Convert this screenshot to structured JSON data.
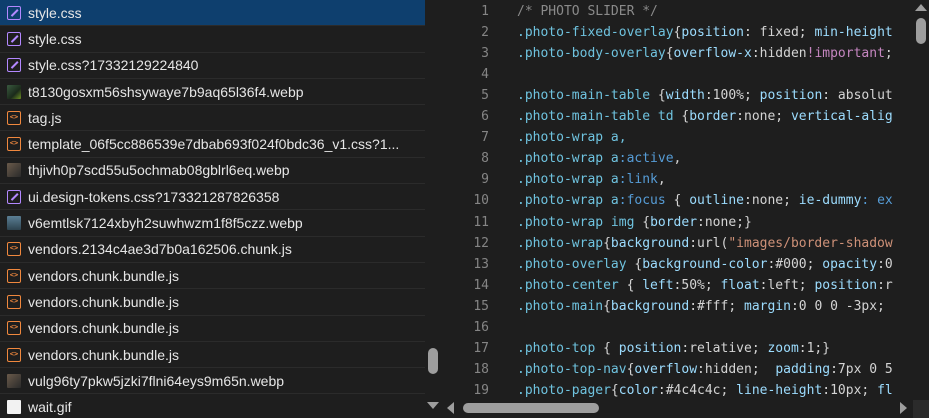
{
  "files": [
    {
      "name": "style.css",
      "type": "css",
      "selected": true
    },
    {
      "name": "style.css",
      "type": "css",
      "selected": false
    },
    {
      "name": "style.css?17332129224840",
      "type": "css",
      "selected": false
    },
    {
      "name": "t8130gosxm56shsywaye7b9aq65l36f4.webp",
      "type": "image",
      "selected": false
    },
    {
      "name": "tag.js",
      "type": "js",
      "selected": false
    },
    {
      "name": "template_06f5cc886539e7dbab693f024f0bdc36_v1.css?1...",
      "type": "js",
      "selected": false
    },
    {
      "name": "thjivh0p7scd55u5ochmab08gblrl6eq.webp",
      "type": "image2",
      "selected": false
    },
    {
      "name": "ui.design-tokens.css?173321287826358",
      "type": "css",
      "selected": false
    },
    {
      "name": "v6emtlsk7124xbyh2suwhwzm1f8f5czz.webp",
      "type": "image3",
      "selected": false
    },
    {
      "name": "vendors.2134c4ae3d7b0a162506.chunk.js",
      "type": "js",
      "selected": false
    },
    {
      "name": "vendors.chunk.bundle.js",
      "type": "js",
      "selected": false
    },
    {
      "name": "vendors.chunk.bundle.js",
      "type": "js",
      "selected": false
    },
    {
      "name": "vendors.chunk.bundle.js",
      "type": "js",
      "selected": false
    },
    {
      "name": "vendors.chunk.bundle.js",
      "type": "js",
      "selected": false
    },
    {
      "name": "vulg96ty7pkw5jzki7flni64eys9m65n.webp",
      "type": "image2",
      "selected": false
    },
    {
      "name": "wait.gif",
      "type": "gif",
      "selected": false
    }
  ],
  "code": {
    "lines": [
      {
        "n": "1",
        "tokens": [
          {
            "t": "/* PHOTO SLIDER */",
            "c": "com"
          }
        ]
      },
      {
        "n": "2",
        "tokens": [
          {
            "t": ".photo-fixed-overlay",
            "c": "sel"
          },
          {
            "t": "{",
            "c": "p"
          },
          {
            "t": "position",
            "c": "prop"
          },
          {
            "t": ": ",
            "c": "p"
          },
          {
            "t": "fixed",
            "c": "p"
          },
          {
            "t": "; ",
            "c": "p"
          },
          {
            "t": "min-height",
            "c": "prop"
          }
        ]
      },
      {
        "n": "3",
        "tokens": [
          {
            "t": ".photo-body-overlay",
            "c": "sel"
          },
          {
            "t": "{",
            "c": "p"
          },
          {
            "t": "overflow-x",
            "c": "prop"
          },
          {
            "t": ":hidden",
            "c": "p"
          },
          {
            "t": "!important",
            "c": "imp"
          },
          {
            "t": ";",
            "c": "p"
          }
        ]
      },
      {
        "n": "4",
        "tokens": []
      },
      {
        "n": "5",
        "tokens": [
          {
            "t": ".photo-main-table ",
            "c": "sel"
          },
          {
            "t": "{",
            "c": "p"
          },
          {
            "t": "width",
            "c": "prop"
          },
          {
            "t": ":100%; ",
            "c": "p"
          },
          {
            "t": "position",
            "c": "prop"
          },
          {
            "t": ": absolut",
            "c": "p"
          }
        ]
      },
      {
        "n": "6",
        "tokens": [
          {
            "t": ".photo-main-table td ",
            "c": "sel"
          },
          {
            "t": "{",
            "c": "p"
          },
          {
            "t": "border",
            "c": "prop"
          },
          {
            "t": ":none; ",
            "c": "p"
          },
          {
            "t": "vertical-alig",
            "c": "prop"
          }
        ]
      },
      {
        "n": "7",
        "tokens": [
          {
            "t": ".photo-wrap a,",
            "c": "sel"
          }
        ]
      },
      {
        "n": "8",
        "tokens": [
          {
            "t": ".photo-wrap a",
            "c": "sel"
          },
          {
            "t": ":active",
            "c": "kw"
          },
          {
            "t": ",",
            "c": "p"
          }
        ]
      },
      {
        "n": "9",
        "tokens": [
          {
            "t": ".photo-wrap a",
            "c": "sel"
          },
          {
            "t": ":link",
            "c": "kw"
          },
          {
            "t": ",",
            "c": "p"
          }
        ]
      },
      {
        "n": "10",
        "tokens": [
          {
            "t": ".photo-wrap a",
            "c": "sel"
          },
          {
            "t": ":focus",
            "c": "kw"
          },
          {
            "t": " { ",
            "c": "p"
          },
          {
            "t": "outline",
            "c": "prop"
          },
          {
            "t": ":none; ",
            "c": "p"
          },
          {
            "t": "ie-dummy",
            "c": "prop"
          },
          {
            "t": ": ex",
            "c": "kw"
          }
        ]
      },
      {
        "n": "11",
        "tokens": [
          {
            "t": ".photo-wrap img ",
            "c": "sel"
          },
          {
            "t": "{",
            "c": "p"
          },
          {
            "t": "border",
            "c": "prop"
          },
          {
            "t": ":none;}",
            "c": "p"
          }
        ]
      },
      {
        "n": "12",
        "tokens": [
          {
            "t": ".photo-wrap",
            "c": "sel"
          },
          {
            "t": "{",
            "c": "p"
          },
          {
            "t": "background",
            "c": "prop"
          },
          {
            "t": ":url(",
            "c": "p"
          },
          {
            "t": "\"images/border-shadow",
            "c": "val"
          }
        ]
      },
      {
        "n": "13",
        "tokens": [
          {
            "t": ".photo-overlay ",
            "c": "sel"
          },
          {
            "t": "{",
            "c": "p"
          },
          {
            "t": "background-color",
            "c": "prop"
          },
          {
            "t": ":#000; ",
            "c": "p"
          },
          {
            "t": "opacity",
            "c": "prop"
          },
          {
            "t": ":0",
            "c": "p"
          }
        ]
      },
      {
        "n": "14",
        "tokens": [
          {
            "t": ".photo-center ",
            "c": "sel"
          },
          {
            "t": "{ ",
            "c": "p"
          },
          {
            "t": "left",
            "c": "prop"
          },
          {
            "t": ":50%; ",
            "c": "p"
          },
          {
            "t": "float",
            "c": "prop"
          },
          {
            "t": ":left; ",
            "c": "p"
          },
          {
            "t": "position",
            "c": "prop"
          },
          {
            "t": ":r",
            "c": "p"
          }
        ]
      },
      {
        "n": "15",
        "tokens": [
          {
            "t": ".photo-main",
            "c": "sel"
          },
          {
            "t": "{",
            "c": "p"
          },
          {
            "t": "background",
            "c": "prop"
          },
          {
            "t": ":#fff; ",
            "c": "p"
          },
          {
            "t": "margin",
            "c": "prop"
          },
          {
            "t": ":0 0 0 -3px; ",
            "c": "p"
          }
        ]
      },
      {
        "n": "16",
        "tokens": []
      },
      {
        "n": "17",
        "tokens": [
          {
            "t": ".photo-top ",
            "c": "sel"
          },
          {
            "t": "{ ",
            "c": "p"
          },
          {
            "t": "position",
            "c": "prop"
          },
          {
            "t": ":relative; ",
            "c": "p"
          },
          {
            "t": "zoom",
            "c": "prop"
          },
          {
            "t": ":1;}",
            "c": "p"
          }
        ]
      },
      {
        "n": "18",
        "tokens": [
          {
            "t": ".photo-top-nav",
            "c": "sel"
          },
          {
            "t": "{",
            "c": "p"
          },
          {
            "t": "overflow",
            "c": "prop"
          },
          {
            "t": ":hidden;  ",
            "c": "p"
          },
          {
            "t": "padding",
            "c": "prop"
          },
          {
            "t": ":7px 0 5",
            "c": "p"
          }
        ]
      },
      {
        "n": "19",
        "tokens": [
          {
            "t": ".photo-pager",
            "c": "sel"
          },
          {
            "t": "{",
            "c": "p"
          },
          {
            "t": "color",
            "c": "prop"
          },
          {
            "t": ":#4c4c4c; ",
            "c": "p"
          },
          {
            "t": "line-height",
            "c": "prop"
          },
          {
            "t": ":10px; ",
            "c": "p"
          },
          {
            "t": "fl",
            "c": "prop"
          }
        ]
      }
    ]
  },
  "colors": {
    "selected_row": "#0e3f6e",
    "background": "#1e1e1e"
  }
}
